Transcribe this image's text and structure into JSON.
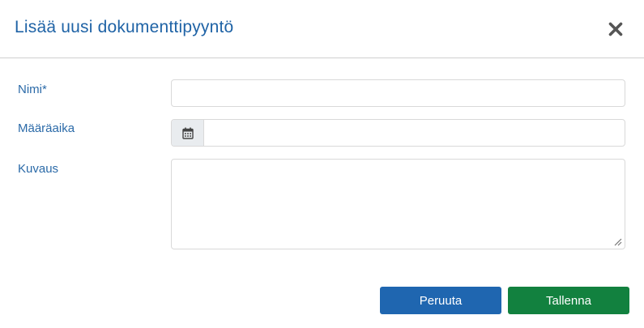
{
  "dialog": {
    "title": "Lisää uusi dokumenttipyyntö",
    "close_icon": "close-icon"
  },
  "form": {
    "name": {
      "label": "Nimi*",
      "value": "",
      "placeholder": ""
    },
    "deadline": {
      "label": "Määräaika",
      "value": "",
      "placeholder": "",
      "icon": "calendar-icon"
    },
    "description": {
      "label": "Kuvaus",
      "value": "",
      "placeholder": ""
    }
  },
  "footer": {
    "cancel_label": "Peruuta",
    "save_label": "Tallenna"
  },
  "colors": {
    "title": "#1f63a6",
    "label": "#2b6aa8",
    "cancel_button": "#1f66b0",
    "save_button": "#12813f",
    "border": "#d9d9d9",
    "addon_bg": "#e9ecef"
  }
}
